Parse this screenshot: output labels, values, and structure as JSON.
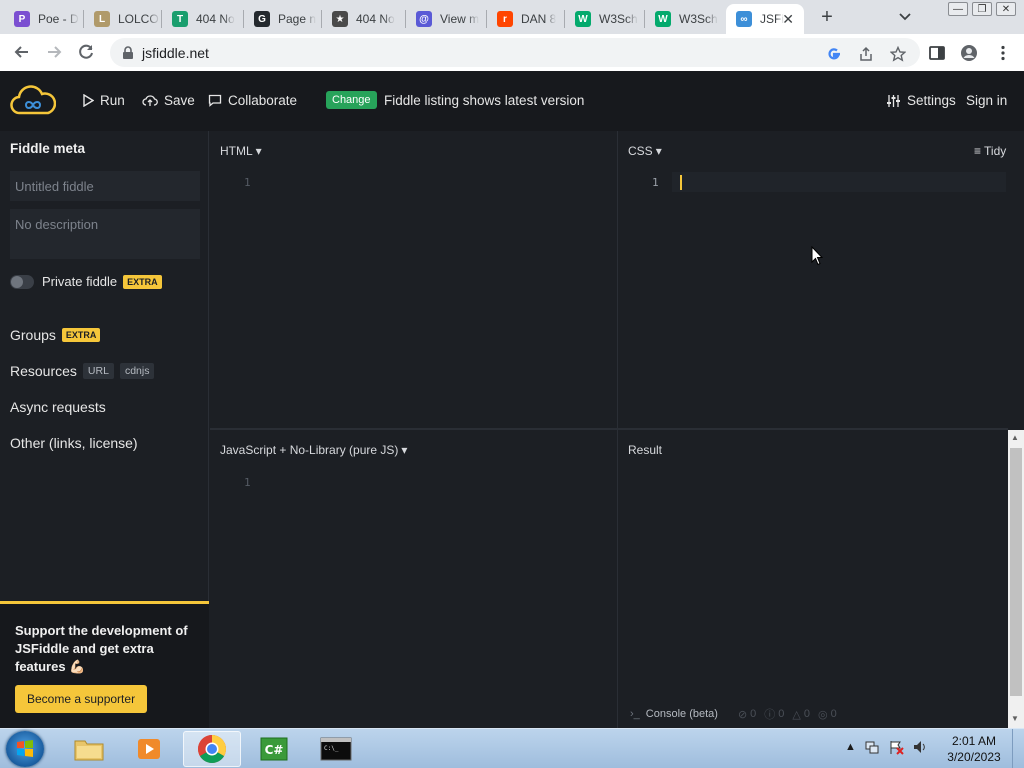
{
  "browser": {
    "tabs": [
      {
        "title": "Poe - D",
        "fav_color": "#7b4fd1",
        "fav_glyph": "P"
      },
      {
        "title": "LOLCOD",
        "fav_color": "#b09a6a",
        "fav_glyph": "L"
      },
      {
        "title": "404 No",
        "fav_color": "#1a9e6e",
        "fav_glyph": "T"
      },
      {
        "title": "Page n",
        "fav_color": "#24292e",
        "fav_glyph": "G"
      },
      {
        "title": "404 No",
        "fav_color": "#4a4a4a",
        "fav_glyph": "★"
      },
      {
        "title": "View m",
        "fav_color": "#5a5ad6",
        "fav_glyph": "@"
      },
      {
        "title": "DAN 8",
        "fav_color": "#ff4500",
        "fav_glyph": "r"
      },
      {
        "title": "W3Sch",
        "fav_color": "#04aa6d",
        "fav_glyph": "W"
      },
      {
        "title": "W3Sch",
        "fav_color": "#04aa6d",
        "fav_glyph": "W"
      },
      {
        "title": "JSFi",
        "fav_color": "#3d8fd8",
        "fav_glyph": "∞",
        "active": true
      }
    ],
    "url": "jsfiddle.net"
  },
  "header": {
    "run": "Run",
    "save": "Save",
    "collaborate": "Collaborate",
    "change_badge": "Change",
    "change_text": "Fiddle listing shows latest version",
    "settings": "Settings",
    "sign_in": "Sign in"
  },
  "sidebar": {
    "title": "Fiddle meta",
    "name_placeholder": "Untitled fiddle",
    "desc_placeholder": "No description",
    "private_label": "Private fiddle",
    "extra_badge": "EXTRA",
    "groups": "Groups",
    "resources": "Resources",
    "url_chip": "URL",
    "cdnjs_chip": "cdnjs",
    "async": "Async requests",
    "other": "Other (links, license)",
    "support_text": "Support the development of JSFiddle and get extra features 💪🏻",
    "support_button": "Become a supporter"
  },
  "panels": {
    "html_label": "HTML",
    "css_label": "CSS",
    "tidy": "Tidy",
    "js_label": "JavaScript + No-Library (pure JS)",
    "result_label": "Result",
    "line_one": "1",
    "console_label": "Console (beta)",
    "console_counts": [
      "0",
      "0",
      "0",
      "0"
    ]
  },
  "taskbar": {
    "time": "2:01 AM",
    "date": "3/20/2023"
  },
  "colors": {
    "accent_yellow": "#f5c63a",
    "change_green": "#27a35a",
    "editor_bg": "#1c1f24"
  }
}
